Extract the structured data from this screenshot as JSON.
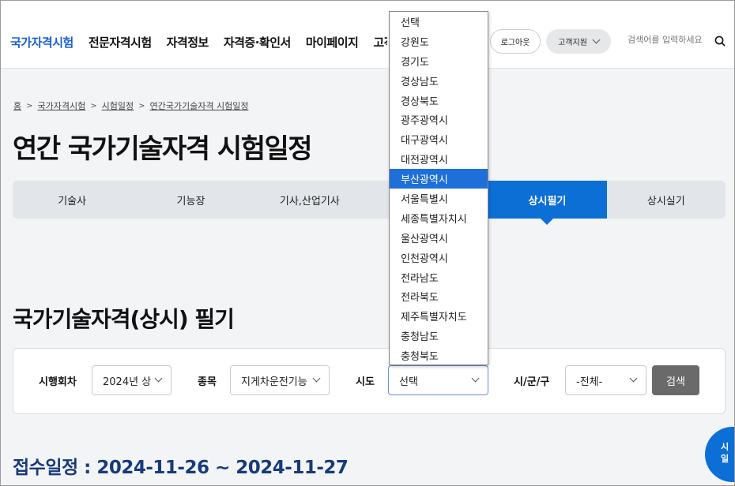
{
  "nav": {
    "items": [
      "국가자격시험",
      "전문자격시험",
      "자격정보",
      "자격증·확인서",
      "마이페이지",
      "고객"
    ],
    "logout_label": "로그아웃",
    "support_label": "고객지원",
    "search_placeholder": "검색어를 입력하세요"
  },
  "breadcrumb": [
    "홈",
    "국가자격시험",
    "시험일정",
    "연간국가기술자격 시험일정"
  ],
  "page_title": "연간 국가기술자격 시험일정",
  "tabs": [
    "기술사",
    "기능장",
    "기사,산업기사",
    "",
    "상시필기",
    "상시실기"
  ],
  "active_tab": "상시필기",
  "section_title": "국가기술자격(상시) 필기",
  "filters": {
    "round_label": "시행회차",
    "round_value": "2024년 상",
    "item_label": "종목",
    "item_value": "지게차운전기능",
    "province_label": "시도",
    "province_value": "선택",
    "city_label": "시/군/구",
    "city_value": "-전체-",
    "search_label": "검색"
  },
  "province_options": [
    "선택",
    "강원도",
    "경기도",
    "경상남도",
    "경상북도",
    "광주광역시",
    "대구광역시",
    "대전광역시",
    "부산광역시",
    "서울특별시",
    "세종특별자치시",
    "울산광역시",
    "인천광역시",
    "전라남도",
    "전라북도",
    "제주특별자치도",
    "충청남도",
    "충청북도"
  ],
  "highlighted_option": "부산광역시",
  "schedule_text": "접수일정 : 2024-11-26 ~ 2024-11-27",
  "fab_text": [
    "시",
    "일"
  ],
  "colors": {
    "accent": "#0c6fd6",
    "nav_active": "#1a5fd0",
    "highlight": "#1e6fd9"
  }
}
